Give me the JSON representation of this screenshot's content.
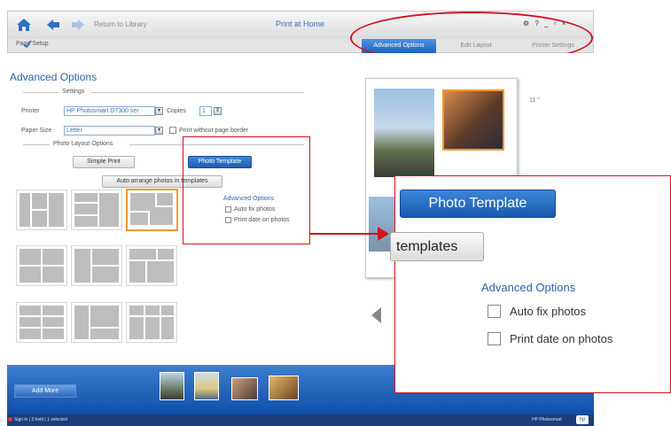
{
  "titlebar": {
    "return_label": "Return to Library",
    "app_title": "Print at Home",
    "window_controls": "⚙ ? _ ▫ ×"
  },
  "toolbar": {
    "page_setup": "Page Setup"
  },
  "tabs": [
    {
      "label": "Advanced Options",
      "active": true
    },
    {
      "label": "Edit Layout",
      "active": false
    },
    {
      "label": "Printer Settings",
      "active": false
    }
  ],
  "panel": {
    "title": "Advanced Options",
    "settings_label": "Settings",
    "printer_label": "Printer",
    "printer_value": "HP Photosmart D7300 ser",
    "copies_label": "Copies",
    "copies_value": "1",
    "paper_size_label": "Paper Size",
    "paper_size_value": "Letter",
    "borderless_label": "Print without page border",
    "layout_options_label": "Photo Layout Options",
    "simple_print_label": "Simple Print",
    "photo_template_label": "Photo Template",
    "auto_arrange_label": "Auto arrange photos in templates",
    "adv_options_label": "Advanced Options",
    "auto_fix_label": "Auto fix photos",
    "print_date_label": "Print date on photos"
  },
  "preview": {
    "size_label": "11 \""
  },
  "bottom": {
    "add_more_label": "Add More",
    "status_text": "Sign in | 3 held | 1 selected",
    "brand_text": "HP Photosmart",
    "logo_text": "hp"
  },
  "callout": {
    "photo_template_label": "Photo Template",
    "templates_label": "templates",
    "adv_options_label": "Advanced Options",
    "auto_fix_label": "Auto fix photos",
    "print_date_label": "Print date on photos"
  },
  "colors": {
    "accent_blue": "#2d61ab",
    "active_tab": "#1f61bd",
    "highlight_red": "#d0121d",
    "selected_thumb": "#f39a2c"
  }
}
